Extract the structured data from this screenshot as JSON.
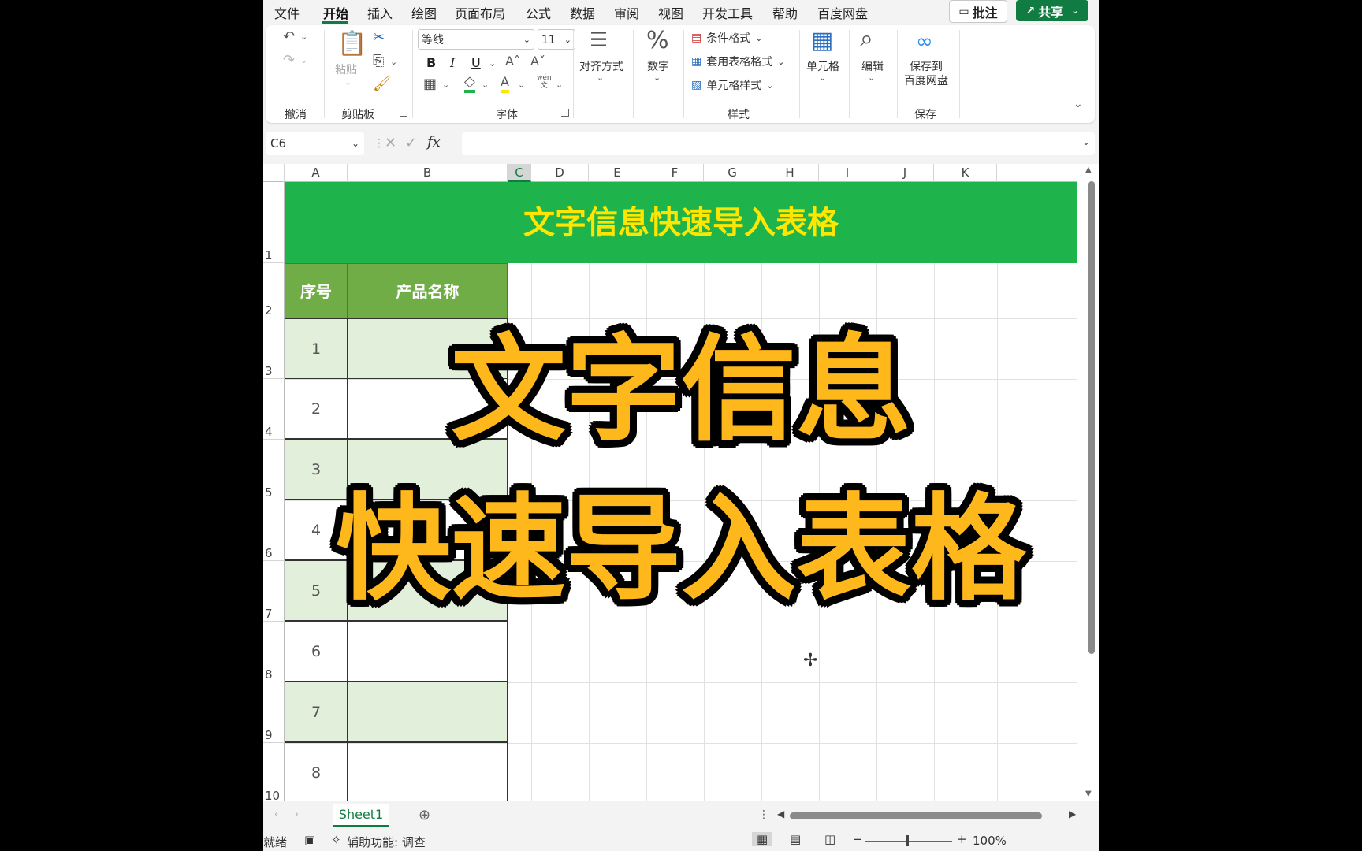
{
  "menu": {
    "tabs": [
      "文件",
      "开始",
      "插入",
      "绘图",
      "页面布局",
      "公式",
      "数据",
      "审阅",
      "视图",
      "开发工具",
      "帮助",
      "百度网盘"
    ],
    "active_tab": "开始",
    "comment_label": "批注",
    "share_label": "共享"
  },
  "ribbon": {
    "undo_group": "撤消",
    "clipboard_group": "剪贴板",
    "paste_label": "粘贴",
    "font_group": "字体",
    "font_name": "等线",
    "font_size": "11",
    "bold": "B",
    "italic": "I",
    "underline": "U",
    "phonetic_top": "wén",
    "phonetic_bottom": "文",
    "align_label": "对齐方式",
    "number_label": "数字",
    "styles_group": "样式",
    "conditional_format": "条件格式",
    "table_format": "套用表格格式",
    "cell_styles": "单元格样式",
    "cells_label": "单元格",
    "edit_label": "编辑",
    "save_baidu_line1": "保存到",
    "save_baidu_line2": "百度网盘",
    "save_group": "保存"
  },
  "formula_bar": {
    "name_box": "C6",
    "fx": "fx",
    "value": ""
  },
  "sheet": {
    "columns": [
      "A",
      "B",
      "C",
      "D",
      "E",
      "F",
      "G",
      "H",
      "I",
      "J",
      "K"
    ],
    "selected_column": "C",
    "rows": [
      "1",
      "2",
      "3",
      "4",
      "5",
      "6",
      "7",
      "8",
      "9",
      "10"
    ],
    "title": "文字信息快速导入表格",
    "header_index": "序号",
    "header_name": "产品名称",
    "serials": [
      "1",
      "2",
      "3",
      "4",
      "5",
      "6",
      "7",
      "8"
    ]
  },
  "overlay": {
    "line1": "文字信息",
    "line2": "快速导入表格"
  },
  "sheet_tabs": [
    "Sheet1"
  ],
  "status": {
    "ready": "就绪",
    "accessibility": "辅助功能: 调查",
    "zoom": "100%"
  },
  "colors": {
    "accent": "#107c41",
    "title_fill": "#1fb34c",
    "title_text": "#ffe600",
    "header_fill": "#70ad47",
    "band_fill": "#e2efda",
    "overlay_text": "#ffb81c"
  }
}
